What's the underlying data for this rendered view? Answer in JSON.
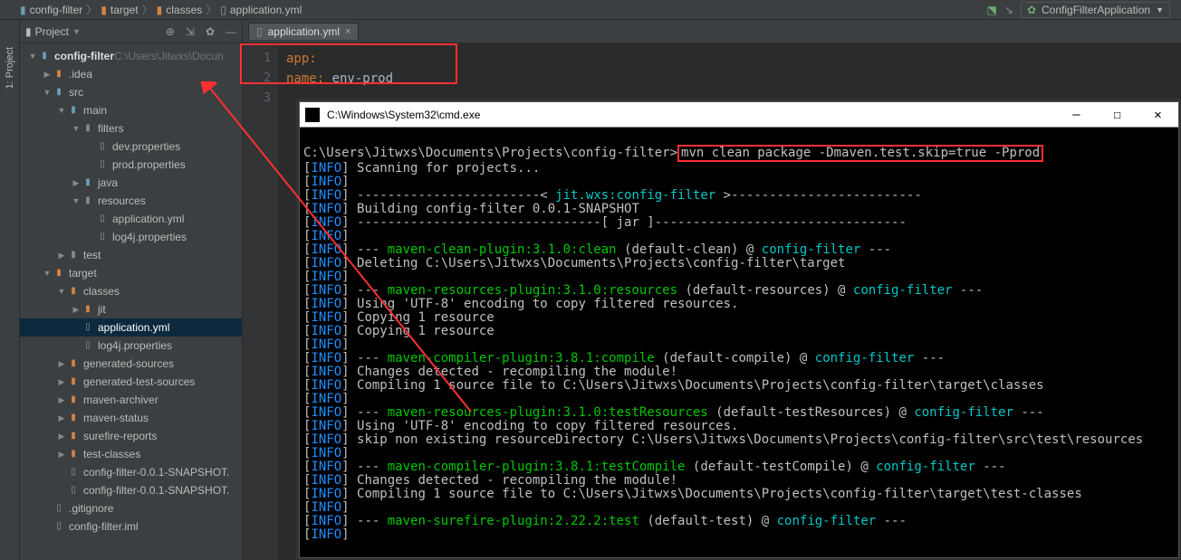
{
  "breadcrumb": {
    "items": [
      "config-filter",
      "target",
      "classes",
      "application.yml"
    ]
  },
  "run_config": {
    "label": "ConfigFilterApplication"
  },
  "sidebar_tab": "1: Project",
  "project": {
    "title": "Project",
    "tree": [
      {
        "depth": 0,
        "arrow": "▼",
        "icon": "folder",
        "iconClass": "folder-blue",
        "name": "config-filter",
        "hint": "  C:\\Users\\Jitwxs\\Docun",
        "bold": true
      },
      {
        "depth": 1,
        "arrow": "▶",
        "icon": "folder",
        "iconClass": "folder-orange",
        "name": ".idea"
      },
      {
        "depth": 1,
        "arrow": "▼",
        "icon": "folder",
        "iconClass": "folder-blue",
        "name": "src"
      },
      {
        "depth": 2,
        "arrow": "▼",
        "icon": "folder",
        "iconClass": "folder-blue",
        "name": "main"
      },
      {
        "depth": 3,
        "arrow": "▼",
        "icon": "folder",
        "iconClass": "folder-gray",
        "name": "filters"
      },
      {
        "depth": 4,
        "arrow": "",
        "icon": "file",
        "iconClass": "file-gray",
        "name": "dev.properties"
      },
      {
        "depth": 4,
        "arrow": "",
        "icon": "file",
        "iconClass": "file-gray",
        "name": "prod.properties"
      },
      {
        "depth": 3,
        "arrow": "▶",
        "icon": "folder",
        "iconClass": "folder-blue",
        "name": "java"
      },
      {
        "depth": 3,
        "arrow": "▼",
        "icon": "folder",
        "iconClass": "folder-gray",
        "name": "resources"
      },
      {
        "depth": 4,
        "arrow": "",
        "icon": "file",
        "iconClass": "file-gray",
        "name": "application.yml"
      },
      {
        "depth": 4,
        "arrow": "",
        "icon": "file",
        "iconClass": "file-gray",
        "name": "log4j.properties"
      },
      {
        "depth": 2,
        "arrow": "▶",
        "icon": "folder",
        "iconClass": "folder-gray",
        "name": "test"
      },
      {
        "depth": 1,
        "arrow": "▼",
        "icon": "folder",
        "iconClass": "folder-orange",
        "name": "target"
      },
      {
        "depth": 2,
        "arrow": "▼",
        "icon": "folder",
        "iconClass": "folder-orange",
        "name": "classes"
      },
      {
        "depth": 3,
        "arrow": "▶",
        "icon": "folder",
        "iconClass": "folder-orange",
        "name": "jit"
      },
      {
        "depth": 3,
        "arrow": "",
        "icon": "file",
        "iconClass": "file-gray",
        "name": "application.yml",
        "selected": true
      },
      {
        "depth": 3,
        "arrow": "",
        "icon": "file",
        "iconClass": "file-gray",
        "name": "log4j.properties"
      },
      {
        "depth": 2,
        "arrow": "▶",
        "icon": "folder",
        "iconClass": "folder-orange",
        "name": "generated-sources"
      },
      {
        "depth": 2,
        "arrow": "▶",
        "icon": "folder",
        "iconClass": "folder-orange",
        "name": "generated-test-sources"
      },
      {
        "depth": 2,
        "arrow": "▶",
        "icon": "folder",
        "iconClass": "folder-orange",
        "name": "maven-archiver"
      },
      {
        "depth": 2,
        "arrow": "▶",
        "icon": "folder",
        "iconClass": "folder-orange",
        "name": "maven-status"
      },
      {
        "depth": 2,
        "arrow": "▶",
        "icon": "folder",
        "iconClass": "folder-orange",
        "name": "surefire-reports"
      },
      {
        "depth": 2,
        "arrow": "▶",
        "icon": "folder",
        "iconClass": "folder-orange",
        "name": "test-classes"
      },
      {
        "depth": 2,
        "arrow": "",
        "icon": "file",
        "iconClass": "file-gray",
        "name": "config-filter-0.0.1-SNAPSHOT."
      },
      {
        "depth": 2,
        "arrow": "",
        "icon": "file",
        "iconClass": "file-gray",
        "name": "config-filter-0.0.1-SNAPSHOT."
      },
      {
        "depth": 1,
        "arrow": "",
        "icon": "file",
        "iconClass": "file-gray",
        "name": ".gitignore"
      },
      {
        "depth": 1,
        "arrow": "",
        "icon": "file",
        "iconClass": "file-gray",
        "name": "config-filter.iml"
      }
    ]
  },
  "editor": {
    "tab_label": "application.yml",
    "line_numbers": [
      "1",
      "2",
      "3"
    ],
    "lines": [
      {
        "key": "app",
        "sep": ":",
        "val": ""
      },
      {
        "indent": "  ",
        "key": "name",
        "sep": ": ",
        "val": "env-prod"
      },
      {
        "key": "",
        "sep": "",
        "val": ""
      }
    ]
  },
  "cmd": {
    "title": "C:\\Windows\\System32\\cmd.exe",
    "prompt_path": "C:\\Users\\Jitwxs\\Documents\\Projects\\config-filter>",
    "command": "mvn clean package -Dmaven.test.skip=true -Pprod",
    "info_tag": "INFO",
    "lines": {
      "scanning": "Scanning for projects...",
      "hdr_open": "------------------------< ",
      "hdr_mid": "jit.wxs:config-filter",
      "hdr_close": " >-------------------------",
      "building": "Building config-filter 0.0.1-SNAPSHOT",
      "jar_line": "--------------------------------[ jar ]---------------------------------",
      "dash3": "---",
      "clean_plugin": "maven-clean-plugin:3.1.0:clean",
      "default_clean": "(default-clean)",
      "at": "@",
      "project_name": "config-filter",
      "deleting": "Deleting C:\\Users\\Jitwxs\\Documents\\Projects\\config-filter\\target",
      "res_plugin": "maven-resources-plugin:3.1.0:resources",
      "default_res": "(default-resources)",
      "utf8": "Using 'UTF-8' encoding to copy filtered resources.",
      "copy1": "Copying 1 resource",
      "compile_plugin": "maven-compiler-plugin:3.8.1:compile",
      "default_compile": "(default-compile)",
      "changes": "Changes detected - recompiling the module!",
      "compile_src": "Compiling 1 source file to C:\\Users\\Jitwxs\\Documents\\Projects\\config-filter\\target\\classes",
      "testres_plugin": "maven-resources-plugin:3.1.0:testResources",
      "default_testres": "(default-testResources)",
      "skip_nonexist": "skip non existing resourceDirectory C:\\Users\\Jitwxs\\Documents\\Projects\\config-filter\\src\\test\\resources",
      "testcompile_plugin": "maven-compiler-plugin:3.8.1:testCompile",
      "default_testcompile": "(default-testCompile)",
      "compile_test": "Compiling 1 source file to C:\\Users\\Jitwxs\\Documents\\Projects\\config-filter\\target\\test-classes",
      "surefire_plugin": "maven-surefire-plugin:2.22.2:test",
      "default_test": "(default-test)"
    }
  }
}
